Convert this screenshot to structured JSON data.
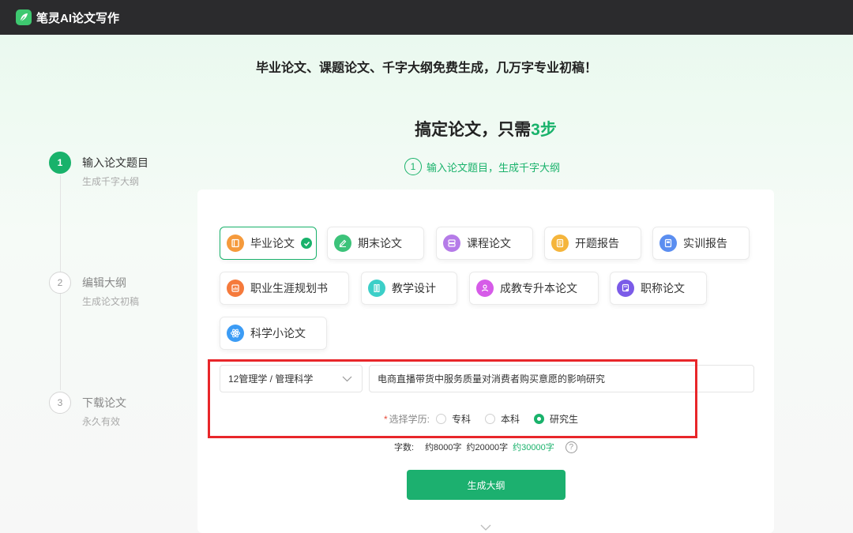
{
  "app": {
    "title": "笔灵AI论文写作"
  },
  "hero": {
    "slogan": "毕业论文、课题论文、千字大纲免费生成，几万字专业初稿！",
    "main_title_prefix": "搞定论文，只需",
    "main_title_highlight": "3步",
    "step_hint_num": "1",
    "step_hint_text": "输入论文题目，生成千字大纲"
  },
  "steps": [
    {
      "num": "1",
      "title": "输入论文题目",
      "sub": "生成千字大纲"
    },
    {
      "num": "2",
      "title": "编辑大纲",
      "sub": "生成论文初稿"
    },
    {
      "num": "3",
      "title": "下载论文",
      "sub": "永久有效"
    }
  ],
  "paper_types": [
    {
      "label": "毕业论文",
      "color": "#f59a3c",
      "icon": "book-icon"
    },
    {
      "label": "期末论文",
      "color": "#3cc37a",
      "icon": "pen-icon"
    },
    {
      "label": "课程论文",
      "color": "#b57be8",
      "icon": "layers-icon"
    },
    {
      "label": "开题报告",
      "color": "#f5b53c",
      "icon": "report-icon"
    },
    {
      "label": "实训报告",
      "color": "#5b8ef0",
      "icon": "document-icon"
    },
    {
      "label": "职业生涯规划书",
      "color": "#f57a3c",
      "icon": "chart-icon"
    },
    {
      "label": "教学设计",
      "color": "#3ccfc8",
      "icon": "ruler-icon"
    },
    {
      "label": "成教专升本论文",
      "color": "#d65be8",
      "icon": "people-icon"
    },
    {
      "label": "职称论文",
      "color": "#7b5be8",
      "icon": "certificate-icon"
    },
    {
      "label": "科学小论文",
      "color": "#3c9cf5",
      "icon": "atom-icon"
    }
  ],
  "form": {
    "subject": "12管理学 / 管理科学",
    "paper_title": "电商直播带货中服务质量对消费者购买意愿的影响研究",
    "education_required_mark": "*",
    "education_label": "选择学历:",
    "education_options": [
      "专科",
      "本科",
      "研究生"
    ],
    "education_selected": "研究生",
    "word_count_label": "字数:",
    "word_count_options": [
      "约8000字",
      "约20000字",
      "约30000字"
    ],
    "word_count_selected": "约30000字",
    "help_glyph": "?",
    "generate_button": "生成大纲"
  },
  "colors": {
    "accent": "#19b26b",
    "highlight_box": "#e8262a",
    "topbar": "#2b2b2d"
  }
}
